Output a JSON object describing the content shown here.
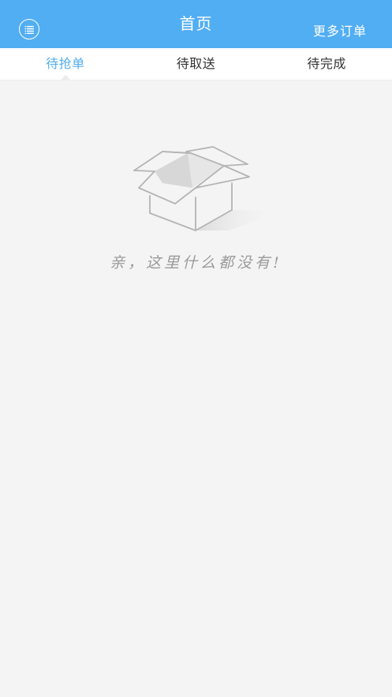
{
  "header": {
    "title": "首页",
    "more_link": "更多订单",
    "menu_icon": "list-menu-icon",
    "background_color": "#52aef3"
  },
  "tabs": [
    {
      "label": "待抢单",
      "active": true
    },
    {
      "label": "待取送",
      "active": false
    },
    {
      "label": "待完成",
      "active": false
    }
  ],
  "empty_state": {
    "icon": "empty-box-icon",
    "message": "亲，这里什么都没有!"
  },
  "colors": {
    "accent": "#52aef3",
    "background": "#f4f4f4",
    "tab_text": "#333333",
    "empty_text": "#9a9a9a"
  }
}
